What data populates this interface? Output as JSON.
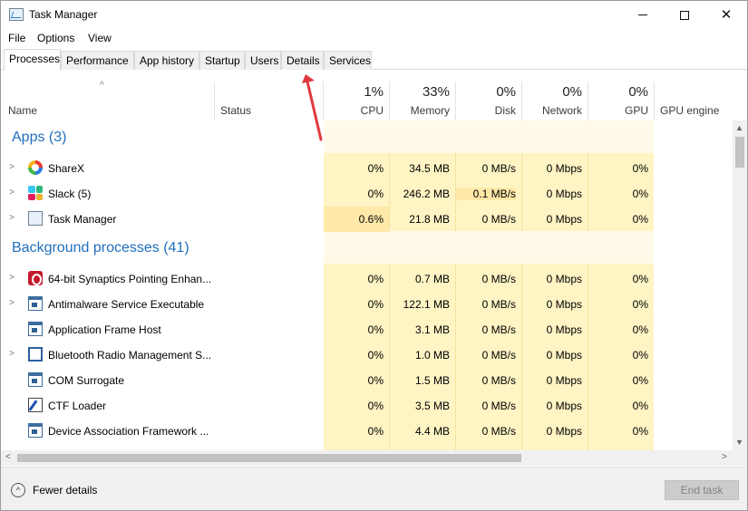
{
  "window": {
    "title": "Task Manager"
  },
  "menu": [
    "File",
    "Options",
    "View"
  ],
  "tabs": [
    "Processes",
    "Performance",
    "App history",
    "Startup",
    "Users",
    "Details",
    "Services"
  ],
  "active_tab": "Processes",
  "columns": {
    "name": "Name",
    "status": "Status",
    "cpu": {
      "pct": "1%",
      "label": "CPU"
    },
    "memory": {
      "pct": "33%",
      "label": "Memory"
    },
    "disk": {
      "pct": "0%",
      "label": "Disk"
    },
    "network": {
      "pct": "0%",
      "label": "Network"
    },
    "gpu": {
      "pct": "0%",
      "label": "GPU"
    },
    "gpu_engine": "GPU engine"
  },
  "groups": {
    "apps": "Apps (3)",
    "background": "Background processes (41)"
  },
  "apps": [
    {
      "name": "ShareX",
      "cpu": "0%",
      "memory": "34.5 MB",
      "disk": "0 MB/s",
      "network": "0 Mbps",
      "gpu": "0%",
      "icon": "sharex-icon"
    },
    {
      "name": "Slack (5)",
      "cpu": "0%",
      "memory": "246.2 MB",
      "disk": "0.1 MB/s",
      "network": "0 Mbps",
      "gpu": "0%",
      "icon": "slack-icon"
    },
    {
      "name": "Task Manager",
      "cpu": "0.6%",
      "memory": "21.8 MB",
      "disk": "0 MB/s",
      "network": "0 Mbps",
      "gpu": "0%",
      "icon": "task-manager-icon"
    }
  ],
  "background": [
    {
      "name": "64-bit Synaptics Pointing Enhan...",
      "cpu": "0%",
      "memory": "0.7 MB",
      "disk": "0 MB/s",
      "network": "0 Mbps",
      "gpu": "0%",
      "icon": "synaptics-icon"
    },
    {
      "name": "Antimalware Service Executable",
      "cpu": "0%",
      "memory": "122.1 MB",
      "disk": "0 MB/s",
      "network": "0 Mbps",
      "gpu": "0%",
      "icon": "service-window-icon"
    },
    {
      "name": "Application Frame Host",
      "cpu": "0%",
      "memory": "3.1 MB",
      "disk": "0 MB/s",
      "network": "0 Mbps",
      "gpu": "0%",
      "icon": "service-window-icon"
    },
    {
      "name": "Bluetooth Radio Management S...",
      "cpu": "0%",
      "memory": "1.0 MB",
      "disk": "0 MB/s",
      "network": "0 Mbps",
      "gpu": "0%",
      "icon": "bluetooth-window-icon"
    },
    {
      "name": "COM Surrogate",
      "cpu": "0%",
      "memory": "1.5 MB",
      "disk": "0 MB/s",
      "network": "0 Mbps",
      "gpu": "0%",
      "icon": "service-window-icon"
    },
    {
      "name": "CTF Loader",
      "cpu": "0%",
      "memory": "3.5 MB",
      "disk": "0 MB/s",
      "network": "0 Mbps",
      "gpu": "0%",
      "icon": "ctf-pen-icon"
    },
    {
      "name": "Device Association Framework ...",
      "cpu": "0%",
      "memory": "4.4 MB",
      "disk": "0 MB/s",
      "network": "0 Mbps",
      "gpu": "0%",
      "icon": "service-window-icon"
    }
  ],
  "footer": {
    "fewer_details": "Fewer details",
    "end_task": "End task"
  },
  "colors": {
    "accent": "#1f6fbd",
    "heat": "#fff4c4",
    "annotation_arrow": "#e0393e"
  }
}
